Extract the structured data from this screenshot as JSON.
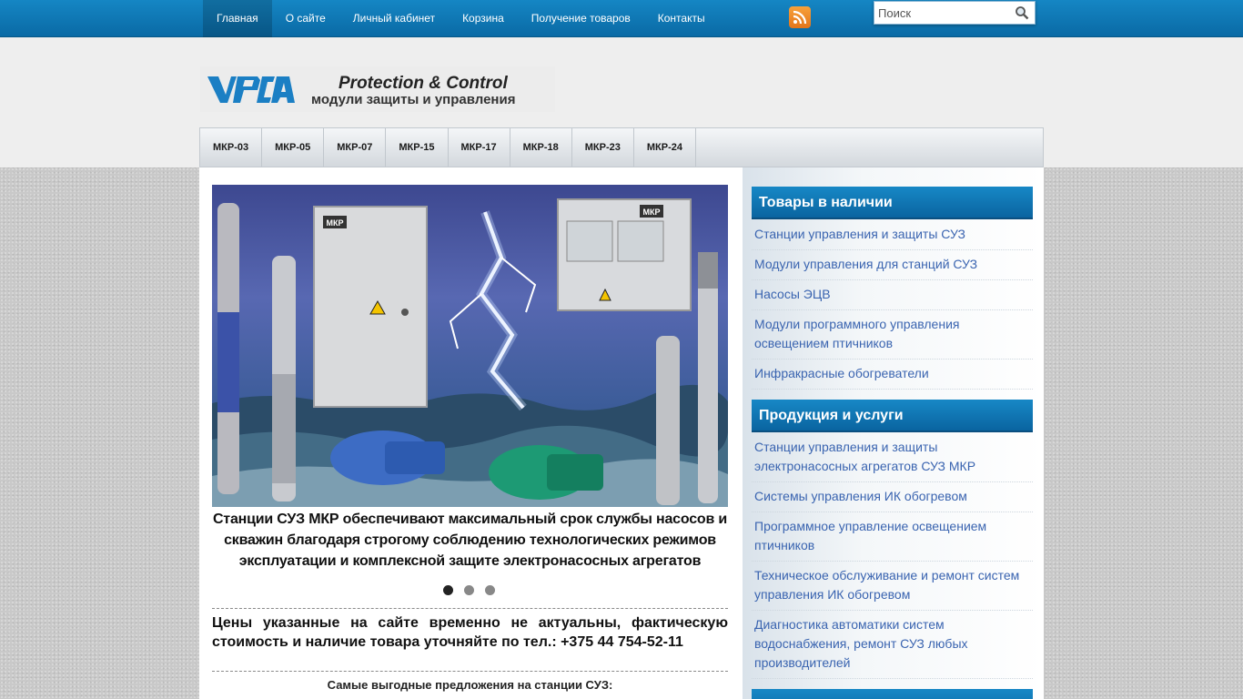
{
  "topnav": {
    "items": [
      "Главная",
      "О сайте",
      "Личный кабинет",
      "Корзина",
      "Получение товаров",
      "Контакты"
    ]
  },
  "search": {
    "placeholder": "Поиск"
  },
  "logo": {
    "tagline_en": "Protection & Control",
    "tagline_ru": "модули защиты и управления"
  },
  "prodnav": {
    "items": [
      "МКР-03",
      "МКР-05",
      "МКР-07",
      "МКР-15",
      "МКР-17",
      "МКР-18",
      "МКР-23",
      "МКР-24"
    ]
  },
  "slider": {
    "caption": "Станции СУЗ МКР обеспечивают максимальный срок службы насосов и скважин благодаря строгому соблюдению технологических режимов эксплуатации и комплексной защите электронасосных агрегатов",
    "active_dot": 1,
    "dot_count": 3,
    "box_labels": [
      "МКР",
      "МКР"
    ]
  },
  "notice": "Цены указанные на сайте временно не актуальны, фактическую стоимость и наличие товара уточняйте по тел.: +375 44 754-52-11",
  "best_offers": "Самые выгодные предложения на станции СУЗ:",
  "sidebar": {
    "stock": {
      "title": "Товары в наличии",
      "items": [
        "Станции управления и защиты СУЗ",
        "Модули управления для станций СУЗ",
        "Насосы ЭЦВ",
        "Модули программного управления освещением птичников",
        "Инфракрасные обогреватели"
      ]
    },
    "products": {
      "title": "Продукция и услуги",
      "items": [
        "Станции управления и защиты электронасосных агрегатов СУЗ МКР",
        "Системы управления ИК обогревом",
        "Программное управление освещением птичников",
        "Техническое обслуживание и ремонт систем управления ИК обогревом",
        "Диагностика автоматики систем водоснабжения, ремонт СУЗ любых производителей"
      ]
    }
  },
  "colors": {
    "topbar": "#0f7ab8",
    "widget_title": "#0f79b6",
    "link": "#3a64b0",
    "rss": "#f08a2a"
  }
}
